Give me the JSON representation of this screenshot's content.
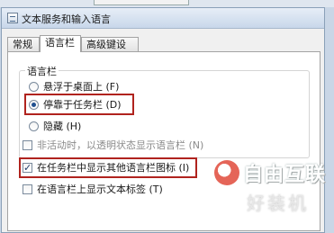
{
  "window": {
    "title": "文本服务和输入语言"
  },
  "tabs": [
    {
      "label": "常规",
      "active": false
    },
    {
      "label": "语言栏",
      "active": true
    },
    {
      "label": "高级键设置",
      "active": false
    }
  ],
  "language_bar": {
    "group_label": "语言栏",
    "options": [
      {
        "label": "悬浮于桌面上 (F)",
        "checked": false
      },
      {
        "label": "停靠于任务栏 (D)",
        "checked": true
      },
      {
        "label": "隐藏 (H)",
        "checked": false
      }
    ]
  },
  "checkboxes": [
    {
      "label": "非活动时，以透明状态显示语言栏 (N)",
      "checked": false
    },
    {
      "label": "在任务栏中显示其他语言栏图标 (I)",
      "checked": true
    },
    {
      "label": "在语言栏上显示文本标签 (T)",
      "checked": false
    }
  ],
  "watermark": {
    "logo_icon": "logo-icon",
    "brand_text": "自由互联",
    "sub_text": "好装机"
  },
  "colors": {
    "highlight": "#b0231e",
    "accent": "#1f4f8f"
  }
}
